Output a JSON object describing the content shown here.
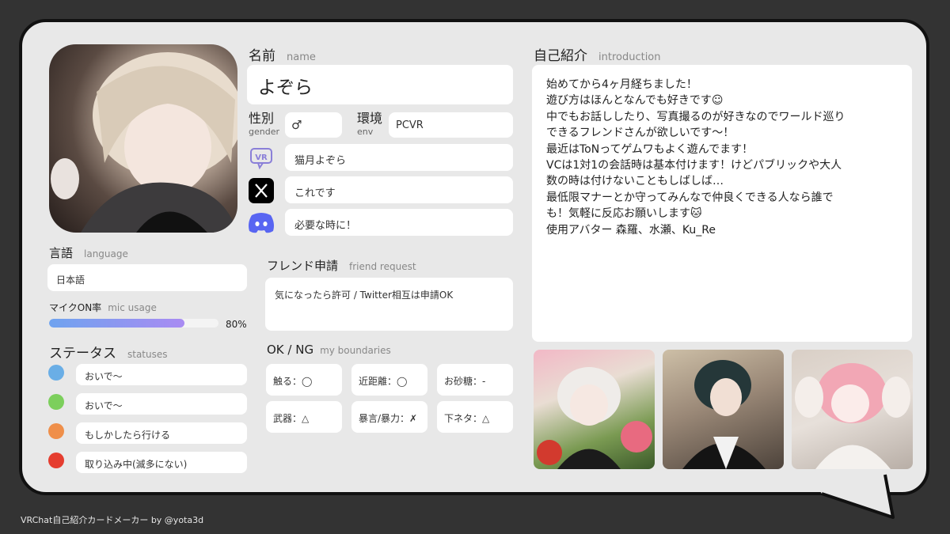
{
  "profile": {
    "name_label": "名前",
    "name_sub": "name",
    "name": "よぞら",
    "gender_label": "性別",
    "gender_sub": "gender",
    "gender": "♂",
    "env_label": "環境",
    "env_sub": "env",
    "env": "PCVR"
  },
  "accounts": {
    "vrchat": "猫月よぞら",
    "x": "これです",
    "discord": "必要な時に！"
  },
  "language": {
    "label": "言語",
    "sub": "language",
    "value": "日本語"
  },
  "mic": {
    "label": "マイクON率",
    "sub": "mic usage",
    "percent_text": "80%",
    "fraction": 0.8
  },
  "statuses": {
    "label": "ステータス",
    "sub": "statuses",
    "items": [
      {
        "color": "#6aaee6",
        "text": "おいで〜"
      },
      {
        "color": "#7ccf5c",
        "text": "おいで〜"
      },
      {
        "color": "#ef8f4a",
        "text": "もしかしたら行ける"
      },
      {
        "color": "#e53d2f",
        "text": "取り込み中(滅多にない)"
      }
    ]
  },
  "friend_request": {
    "label": "フレンド申請",
    "sub": "friend request",
    "value": "気になったら許可 / Twitter相互は申請OK"
  },
  "boundaries": {
    "label": "OK / NG",
    "sub": "my boundaries",
    "items": [
      "触る：◯",
      "近距離：◯",
      "お砂糖：-",
      "武器：△",
      "暴言/暴力：✗",
      "下ネタ：△"
    ]
  },
  "introduction": {
    "label": "自己紹介",
    "sub": "introduction",
    "lines": [
      "始めてから4ヶ月経ちました！",
      "遊び方はほんとなんでも好きです☺",
      "中でもお話ししたり、写真撮るのが好きなのでワールド巡り",
      "できるフレンドさんが欲しいです〜！",
      "最近はToNってゲムワもよく遊んでます！",
      "VCは1対1の会話時は基本付けます！けどパブリックや大人",
      "数の時は付けないこともしばしば…",
      "最低限マナーとか守ってみんなで仲良くできる人なら誰で",
      "も！気軽に反応お願いします🐱",
      "使用アバター 森羅、水瀬、Ku_Re"
    ]
  },
  "footer": "VRChat自己紹介カードメーカー by @yota3d",
  "colors": {
    "background": "#333333",
    "card": "#e8e8e8",
    "mic_bar_start": "#6fa3ef",
    "mic_bar_end": "#a98bf2",
    "discord": "#5865f2",
    "vrchat": "#8a7fd8"
  }
}
